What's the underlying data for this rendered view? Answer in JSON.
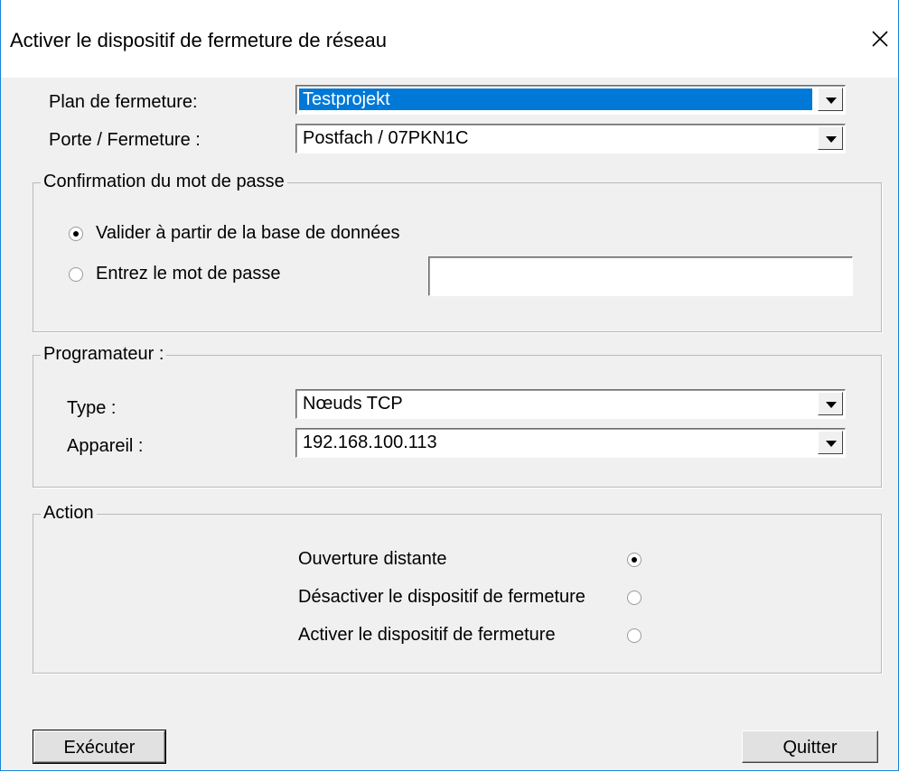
{
  "window": {
    "title": "Activer le dispositif de fermeture de réseau",
    "close_icon": "close-icon"
  },
  "plan": {
    "label": "Plan de fermeture:",
    "value": "Testprojekt"
  },
  "porte": {
    "label": "Porte / Fermeture :",
    "value": "Postfach / 07PKN1C"
  },
  "password_group": {
    "title": "Confirmation du mot de passe",
    "option_db": "Valider à partir de la base de données",
    "option_enter": "Entrez le mot de passe",
    "password_value": "",
    "selected": "option_db"
  },
  "programmer_group": {
    "title": "Programateur :",
    "type_label": "Type :",
    "type_value": "Nœuds TCP",
    "device_label": "Appareil :",
    "device_value": "192.168.100.113"
  },
  "action_group": {
    "title": "Action",
    "options": [
      {
        "label": "Ouverture distante",
        "selected": true
      },
      {
        "label": "Désactiver le dispositif de fermeture",
        "selected": false
      },
      {
        "label": "Activer le dispositif de fermeture",
        "selected": false
      }
    ]
  },
  "buttons": {
    "execute": "Exécuter",
    "quit": "Quitter"
  },
  "colors": {
    "accent": "#0078d7",
    "border": "#1883d7",
    "face": "#f0f0f0"
  }
}
